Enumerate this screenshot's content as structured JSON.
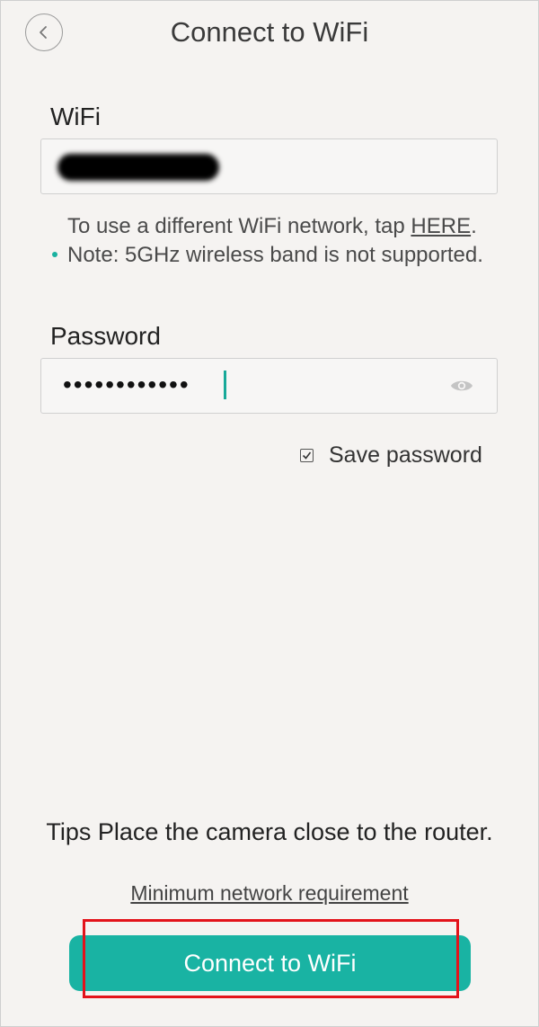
{
  "header": {
    "title": "Connect to WiFi",
    "back_icon": "chevron-left-icon"
  },
  "wifi": {
    "label": "WiFi",
    "value": "(redacted network name)"
  },
  "hint": {
    "before": "To use a different WiFi network, tap ",
    "link": "HERE",
    "after": ". Note: 5GHz wireless band is not supported."
  },
  "password": {
    "label": "Password",
    "masked_value": "••••••••••••",
    "toggle_icon": "eye-icon"
  },
  "save_password": {
    "label": "Save password",
    "checked": true
  },
  "tips": "Tips Place the camera close to the router.",
  "min_requirement_link": "Minimum network requirement",
  "connect_button": "Connect to WiFi",
  "colors": {
    "background": "#f5f3f1",
    "accent": "#19b3a3",
    "highlight": "#e3131b"
  }
}
